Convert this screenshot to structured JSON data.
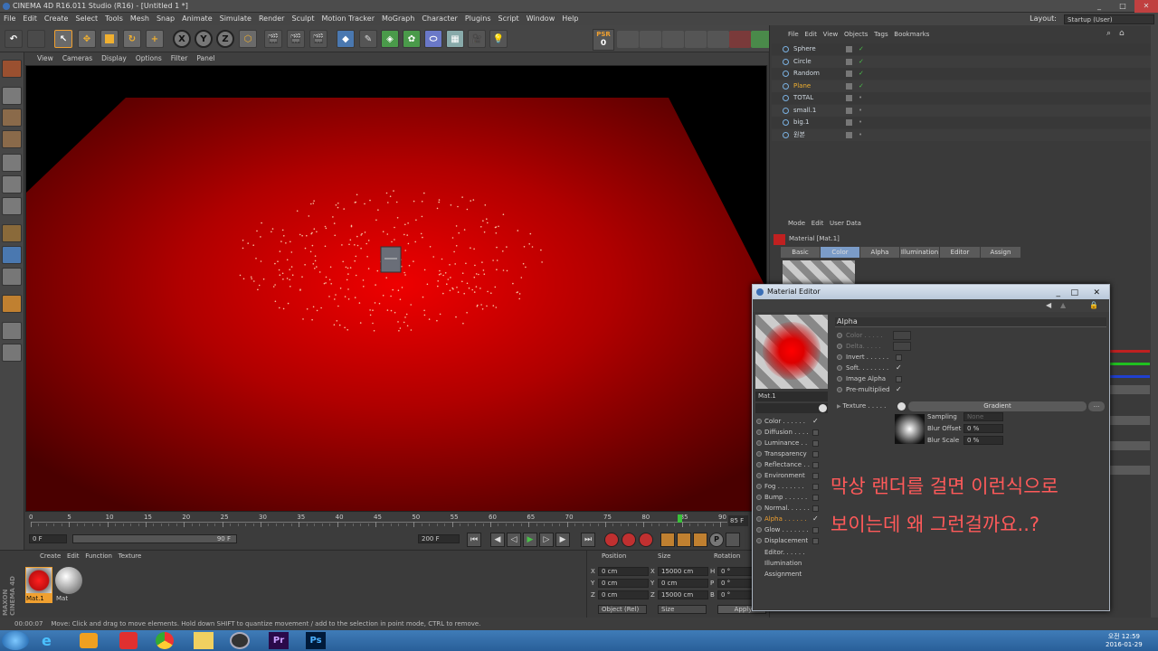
{
  "window": {
    "title": "CINEMA 4D R16.011 Studio (R16) - [Untitled 1 *]",
    "min": "_",
    "max": "□",
    "close": "✕"
  },
  "menubar": [
    "File",
    "Edit",
    "Create",
    "Select",
    "Tools",
    "Mesh",
    "Snap",
    "Animate",
    "Simulate",
    "Render",
    "Sculpt",
    "Motion Tracker",
    "MoGraph",
    "Character",
    "Plugins",
    "Script",
    "Window",
    "Help"
  ],
  "layout": {
    "label": "Layout:",
    "value": "Startup (User)"
  },
  "toolbar": {
    "x": "X",
    "y": "Y",
    "z": "Z",
    "psr": "PSR",
    "psr_value": "0"
  },
  "viewport_menu": [
    "View",
    "Cameras",
    "Display",
    "Options",
    "Filter",
    "Panel"
  ],
  "timeline": {
    "ticks": [
      "0",
      "5",
      "10",
      "15",
      "20",
      "25",
      "30",
      "35",
      "40",
      "45",
      "50",
      "55",
      "60",
      "65",
      "70",
      "75",
      "80",
      "85",
      "90"
    ],
    "current": "85",
    "end_label": "85 F",
    "start_field": "0 F",
    "range_field": "90 F",
    "end_field": "200 F"
  },
  "material_manager": {
    "menu": [
      "Create",
      "Edit",
      "Function",
      "Texture"
    ],
    "materials": [
      {
        "name": "Mat.1"
      },
      {
        "name": "Mat"
      }
    ],
    "brand": [
      "MAXON",
      "CINEMA 4D"
    ]
  },
  "coordinates": {
    "headers": [
      "Position",
      "Size",
      "Rotation"
    ],
    "rows": [
      {
        "axis": "X",
        "pos": "0 cm",
        "saxis": "X",
        "size": "15000 cm",
        "raxis": "H",
        "rot": "0 °"
      },
      {
        "axis": "Y",
        "pos": "0 cm",
        "saxis": "Y",
        "size": "0 cm",
        "raxis": "P",
        "rot": "0 °"
      },
      {
        "axis": "Z",
        "pos": "0 cm",
        "saxis": "Z",
        "size": "15000 cm",
        "raxis": "B",
        "rot": "0 °"
      }
    ],
    "mode": "Object (Rel)",
    "size_mode": "Size",
    "apply": "Apply"
  },
  "object_manager": {
    "menu": [
      "File",
      "Edit",
      "View",
      "Objects",
      "Tags",
      "Bookmarks"
    ],
    "objects": [
      {
        "name": "Sphere",
        "color": "#cfd8e0"
      },
      {
        "name": "Circle",
        "color": "#cfd8e0"
      },
      {
        "name": "Random",
        "color": "#cfd8e0"
      },
      {
        "name": "Plane",
        "color": "#f0b030"
      },
      {
        "name": "TOTAL",
        "color": "#cfd8e0"
      },
      {
        "name": "small.1",
        "color": "#cfd8e0"
      },
      {
        "name": "big.1",
        "color": "#cfd8e0"
      },
      {
        "name": "원본",
        "color": "#cfd8e0"
      }
    ]
  },
  "attributes": {
    "menu": [
      "Mode",
      "Edit",
      "User Data"
    ],
    "title": "Material [Mat.1]",
    "tabs": [
      "Basic",
      "Color",
      "Alpha",
      "Illumination",
      "Editor",
      "Assign"
    ]
  },
  "material_editor": {
    "title": "Material Editor",
    "mat_name": "Mat.1",
    "section": "Alpha",
    "channels": [
      {
        "label": "Color . . . . . .",
        "checked": true
      },
      {
        "label": "Diffusion . . . .",
        "checked": false
      },
      {
        "label": "Luminance . .",
        "checked": false
      },
      {
        "label": "Transparency",
        "checked": false
      },
      {
        "label": "Reflectance . .",
        "checked": false
      },
      {
        "label": "Environment",
        "checked": false
      },
      {
        "label": "Fog . . . . . . .",
        "checked": false
      },
      {
        "label": "Bump . . . . . .",
        "checked": false
      },
      {
        "label": "Normal. . . . . .",
        "checked": false
      },
      {
        "label": "Alpha . . . . . .",
        "checked": true
      },
      {
        "label": "Glow . . . . . . .",
        "checked": false
      },
      {
        "label": "Displacement",
        "checked": false
      }
    ],
    "extra": [
      "Editor. . . . . .",
      "Illumination",
      "Assignment"
    ],
    "props": [
      {
        "label": "Color . . . . .",
        "type": "swatch"
      },
      {
        "label": "Delta. . . . .",
        "type": "swatch"
      },
      {
        "label": "Invert . . . . . .",
        "checked": false
      },
      {
        "label": "Soft. . . . . . . .",
        "checked": true
      },
      {
        "label": "Image Alpha",
        "checked": false
      },
      {
        "label": "Pre-multiplied",
        "checked": true
      }
    ],
    "texture_label": "Texture . . . . .",
    "texture_value": "Gradient",
    "sampling_label": "Sampling",
    "sampling_value": "None",
    "blur_offset_label": "Blur Offset",
    "blur_offset_value": "0 %",
    "blur_scale_label": "Blur Scale",
    "blur_scale_value": "0 %",
    "ellipsis": "..."
  },
  "annotation": {
    "line1": "막상 랜더를 걸면 이런식으로",
    "line2": "보이는데 왜 그런걸까요..?"
  },
  "status": {
    "time": "00:00:07",
    "text": "Move: Click and drag to move elements. Hold down SHIFT to quantize movement / add to the selection in point mode, CTRL to remove."
  },
  "taskbar": {
    "time": "오전 12:59",
    "date": "2016-01-29"
  },
  "colors": {
    "accent": "#f0a030",
    "viewport_red": "#e00000",
    "annotation": "#ff5a5a"
  }
}
